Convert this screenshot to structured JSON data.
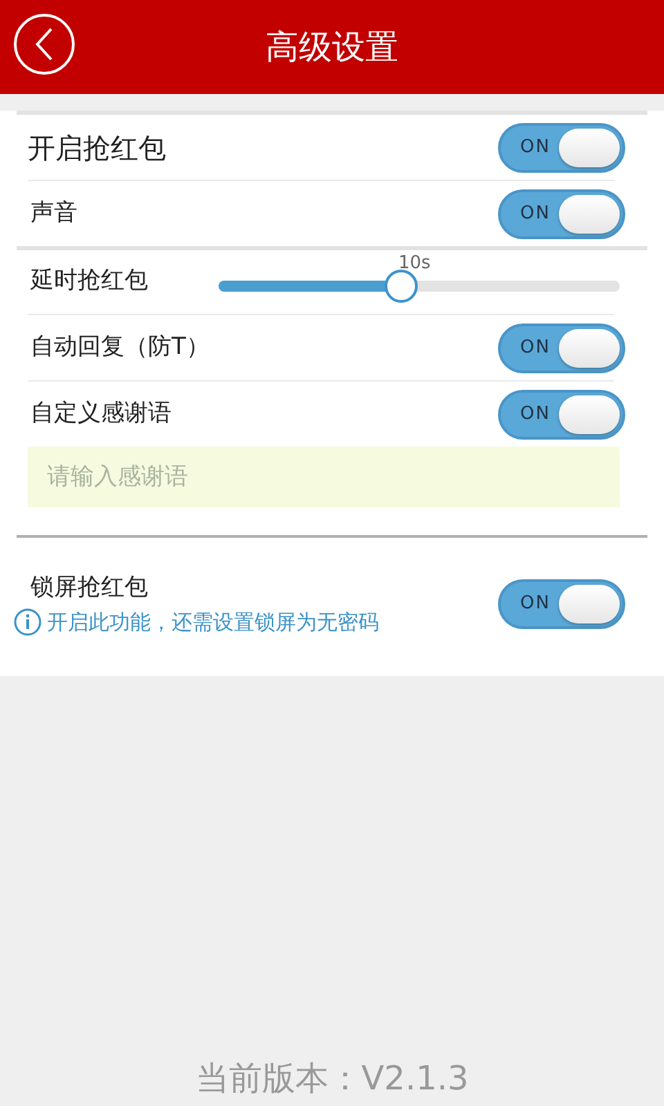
{
  "header": {
    "title": "高级设置"
  },
  "sections": [
    {
      "items": [
        {
          "kind": "switch",
          "label": "开启抢红包",
          "on": true,
          "switch_text": "ON"
        },
        {
          "kind": "switch",
          "label": "声音",
          "on": true,
          "switch_text": "ON"
        }
      ]
    },
    {
      "items": [
        {
          "kind": "slider",
          "label": "延时抢红包",
          "level": 0.455,
          "reading": "10s"
        },
        {
          "kind": "switch",
          "label": "自动回复（防T）",
          "on": true,
          "switch_text": "ON"
        },
        {
          "kind": "switch",
          "label": "自定义感谢语",
          "on": true,
          "switch_text": "ON"
        },
        {
          "kind": "input",
          "placeholder": "请输入感谢语"
        }
      ]
    },
    {
      "items": [
        {
          "kind": "switch",
          "label": "锁屏抢红包",
          "on": true,
          "switch_text": "ON",
          "note": "开启此功能，还需设置锁屏为无密码"
        }
      ]
    }
  ],
  "footer": {
    "version": "当前版本：V2.1.3"
  }
}
